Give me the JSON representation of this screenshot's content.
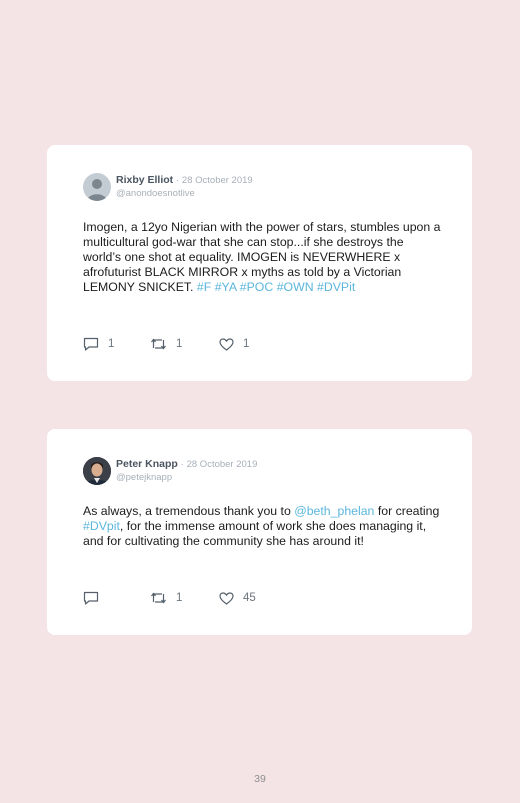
{
  "tweets": [
    {
      "author": "Rixby Elliot",
      "separator": "·",
      "date": "28 October 2019",
      "handle": "@anondoesnotlive",
      "text_plain": "Imogen, a 12yo Nigerian with the power of stars, stumbles upon a multicultural god-war that she can stop...if she destroys the world’s one shot at equality. IMOGEN is NEVERWHERE x afrofuturist BLACK MIRROR x myths as told by a Victorian LEMONY SNICKET.",
      "tag_f": "#F",
      "tag_ya": "#YA",
      "tag_poc": "#POC",
      "tag_own": "#OWN",
      "tag_dvpit": "#DVPit",
      "replies": "1",
      "retweets": "1",
      "likes": "1"
    },
    {
      "author": "Peter Knapp",
      "separator": "·",
      "date": "28 October 2019",
      "handle": "@petejknapp",
      "text_1": "As always, a tremendous thank you to",
      "mention": "@beth_phelan",
      "text_2": "for creating",
      "tag_dvpit": "#DVpit",
      "text_3": ", for the immense amount of work she does managing it, and for cultivating the community she has around it!",
      "replies": "",
      "retweets": "1",
      "likes": "45"
    }
  ],
  "page_number": "39",
  "colors": {
    "background": "#f5e4e5",
    "card": "#ffffff",
    "link": "#5bb6dc",
    "muted": "#a7b0b8"
  }
}
